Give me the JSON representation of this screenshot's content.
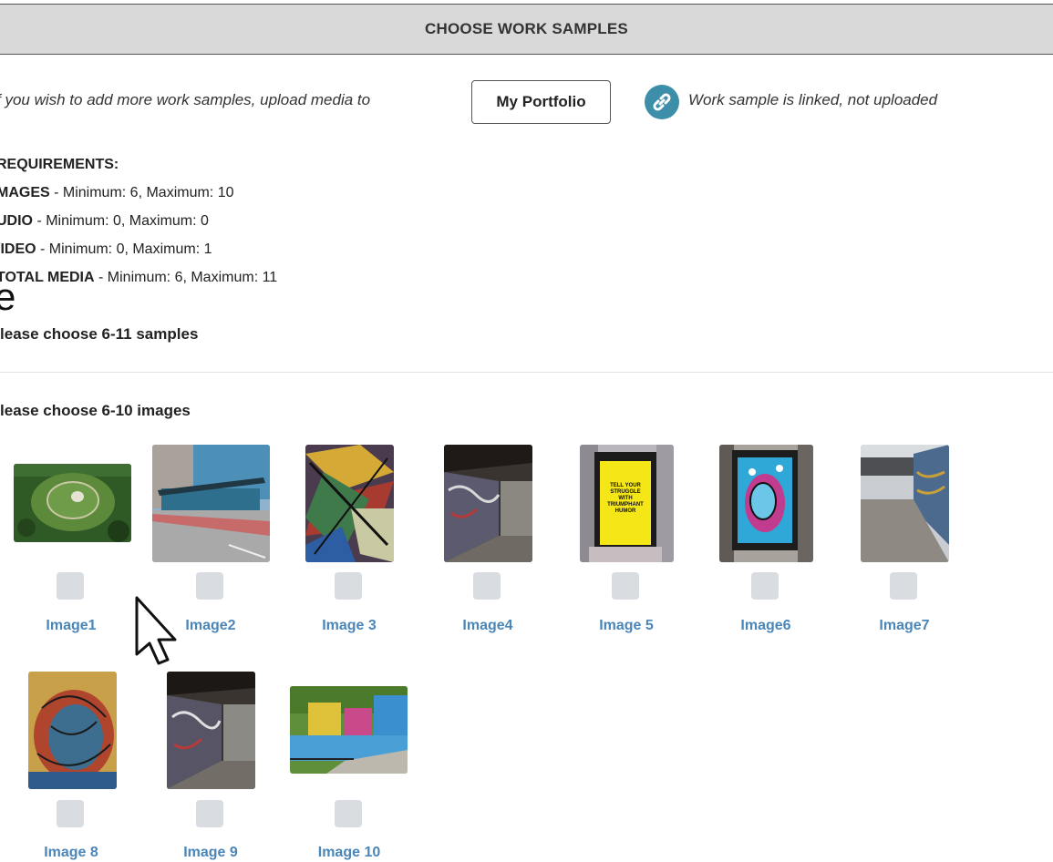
{
  "header": {
    "title": "CHOOSE WORK SAMPLES"
  },
  "intro": {
    "text": "f you wish to add more work samples, upload media to",
    "portfolio_button": "My Portfolio",
    "link_note": "Work sample is linked, not uploaded"
  },
  "requirements": {
    "heading": "REQUIREMENTS:",
    "images_label": "MAGES",
    "images_value": " - Minimum: 6, Maximum: 10",
    "audio_label": "UDIO",
    "audio_value": " - Minimum: 0, Maximum: 0",
    "video_label": "/IDEO",
    "video_value": " - Minimum: 0, Maximum: 1",
    "total_label": "TOTAL MEDIA",
    "total_value": " - Minimum: 6, Maximum: 11"
  },
  "stray_text": "e",
  "choose_samples": "'lease choose 6-11 samples",
  "choose_images": "'lease choose 6-10 images",
  "images": [
    {
      "label": "Image1"
    },
    {
      "label": "Image2"
    },
    {
      "label": "Image 3"
    },
    {
      "label": "Image4"
    },
    {
      "label": "Image 5"
    },
    {
      "label": "Image6"
    },
    {
      "label": "Image7"
    },
    {
      "label": "Image 8"
    },
    {
      "label": "Image 9"
    },
    {
      "label": "Image 10"
    }
  ],
  "poster_text": "TELL YOUR STRUGGLE WITH TRIUMPHANT HUMOR",
  "colors": {
    "link_blue": "#4a86b8",
    "link_icon_bg": "#3d8ea8",
    "header_bg": "#d9d9d9"
  }
}
